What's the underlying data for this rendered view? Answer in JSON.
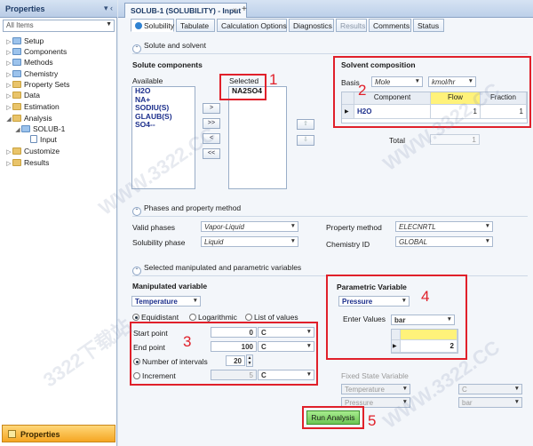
{
  "nav": {
    "title": "Properties",
    "pin_glyph": "▾ ‹",
    "filter": "All Items",
    "tree": [
      {
        "label": "Setup",
        "depth": 0,
        "icon": "folder-ok-icon"
      },
      {
        "label": "Components",
        "depth": 0,
        "icon": "folder-ok-icon"
      },
      {
        "label": "Methods",
        "depth": 0,
        "icon": "folder-ok-icon"
      },
      {
        "label": "Chemistry",
        "depth": 0,
        "icon": "folder-ok-icon"
      },
      {
        "label": "Property Sets",
        "depth": 0,
        "icon": "folder-icon"
      },
      {
        "label": "Data",
        "depth": 0,
        "icon": "folder-icon"
      },
      {
        "label": "Estimation",
        "depth": 0,
        "icon": "folder-icon"
      },
      {
        "label": "Analysis",
        "depth": 0,
        "icon": "folder-icon"
      },
      {
        "label": "SOLUB-1",
        "depth": 1,
        "icon": "folder-ok-icon"
      },
      {
        "label": "Input",
        "depth": 2,
        "icon": "form-icon"
      },
      {
        "label": "Customize",
        "depth": 0,
        "icon": "folder-icon"
      },
      {
        "label": "Results",
        "depth": 0,
        "icon": "folder-icon"
      }
    ],
    "bottom_button": "Properties"
  },
  "doc": {
    "tab_title": "SOLUB-1 (SOLUBILITY) - Input",
    "close_glyph": "×",
    "new_glyph": "+",
    "subtabs": [
      "Solubility",
      "Tabulate",
      "Calculation Options",
      "Diagnostics",
      "Results",
      "Comments",
      "Status"
    ]
  },
  "solute_section": {
    "header": "Solute and solvent",
    "solute_title": "Solute components",
    "available_label": "Available",
    "available": [
      "H2O",
      "NA+",
      "SODIU(S)",
      "GLAUB(S)",
      "SO4--"
    ],
    "selected_label": "Selected",
    "selected": [
      "NA2SO4"
    ],
    "move_buttons": [
      ">",
      ">>",
      "<",
      "<<"
    ],
    "up_glyph": "⇧",
    "down_glyph": "⇩"
  },
  "solvent": {
    "title": "Solvent composition",
    "basis_label": "Basis",
    "basis_value": "Mole",
    "units_value": "kmol/hr",
    "columns": [
      "Component",
      "Flow",
      "Fraction"
    ],
    "row_marker": "▶",
    "rows": [
      {
        "component": "H2O",
        "flow": "1",
        "fraction": "1"
      }
    ],
    "total_label": "Total",
    "total_value": "1"
  },
  "phases": {
    "header": "Phases and property method",
    "valid_phases_label": "Valid phases",
    "valid_phases": "Vapor-Liquid",
    "solubility_phase_label": "Solubility phase",
    "solubility_phase": "Liquid",
    "property_method_label": "Property method",
    "property_method": "ELECNRTL",
    "chemistry_id_label": "Chemistry ID",
    "chemistry_id": "GLOBAL"
  },
  "manipulated": {
    "header": "Selected manipulated and parametric variables",
    "title": "Manipulated variable",
    "variable": "Temperature",
    "spacing": [
      "Equidistant",
      "Logarithmic",
      "List of values"
    ],
    "start_label": "Start point",
    "start_value": "0",
    "start_unit": "C",
    "end_label": "End point",
    "end_value": "100",
    "end_unit": "C",
    "intervals_label": "Number of intervals",
    "intervals_value": "20",
    "increment_label": "Increment",
    "increment_value": "5",
    "increment_unit": "C"
  },
  "parametric": {
    "title": "Parametric Variable",
    "variable": "Pressure",
    "enter_values_label": "Enter Values",
    "units": "bar",
    "row_marker": "▶",
    "value": "2"
  },
  "fixed": {
    "title": "Fixed State Variable",
    "var1": "Temperature",
    "unit1": "C",
    "var2": "Pressure",
    "unit2": "bar"
  },
  "run_button": "Run Analysis",
  "annotations": [
    "1",
    "2",
    "3",
    "4",
    "5"
  ],
  "watermarks": [
    "WWW.3322.CC",
    "3322下载站"
  ],
  "colors": {
    "accent": "#e0202a",
    "run": "#7fd36b",
    "flow_header": "#fff27a"
  }
}
